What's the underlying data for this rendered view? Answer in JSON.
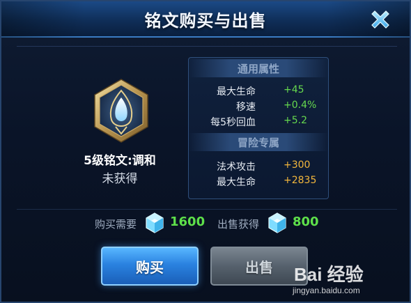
{
  "dialog": {
    "title": "铭文购买与出售"
  },
  "rune": {
    "name": "5级铭文:调和",
    "status": "未获得"
  },
  "attributes": {
    "general_title": "通用属性",
    "general": [
      {
        "label": "最大生命",
        "value": "+45"
      },
      {
        "label": "移速",
        "value": "+0.4%"
      },
      {
        "label": "每5秒回血",
        "value": "+5.2"
      }
    ],
    "adventure_title": "冒险专属",
    "adventure": [
      {
        "label": "法术攻击",
        "value": "+300"
      },
      {
        "label": "最大生命",
        "value": "+2835"
      }
    ]
  },
  "pricing": {
    "buy_label": "购买需要",
    "buy_value": "1600",
    "sell_label": "出售获得",
    "sell_value": "800",
    "currency_icon": "crystal-gem-icon"
  },
  "actions": {
    "buy_label": "购买",
    "sell_label": "出售"
  },
  "watermark": {
    "brand": "Bai 经验",
    "url": "jingyan.baidu.com"
  },
  "colors": {
    "accent_blue": "#2a82e0",
    "positive_green": "#66d94e",
    "adventure_orange": "#f3b73c",
    "title_bar": "#1b4a86"
  }
}
